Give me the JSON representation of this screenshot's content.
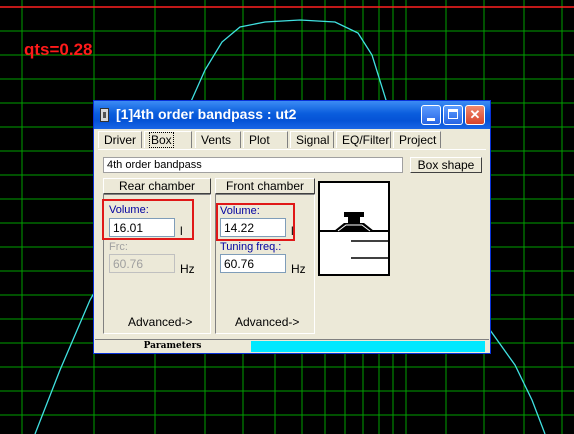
{
  "plot": {
    "annotation": "qts=0.28",
    "colors": {
      "background": "#000000",
      "grid": "#00a000",
      "curve": "#40e0e0",
      "top_line": "#ff2020",
      "annotation": "#ff1a1a"
    }
  },
  "window": {
    "title": "[1]4th order bandpass : ut2",
    "tabs": [
      "Driver",
      "Box",
      "Vents",
      "Plot",
      "Signal",
      "EQ/Filter",
      "Project"
    ],
    "active_tab": "Box",
    "box_type": "4th order bandpass",
    "box_shape_button": "Box shape",
    "rear": {
      "header": "Rear chamber",
      "volume_label": "Volume:",
      "volume_value": "16.01",
      "volume_unit": "l",
      "freq_label": "Frc:",
      "freq_value": "60.76",
      "freq_unit": "Hz",
      "advanced": "Advanced->"
    },
    "front": {
      "header": "Front chamber",
      "volume_label": "Volume:",
      "volume_value": "14.22",
      "volume_unit": "l",
      "freq_label": "Tuning freq.:",
      "freq_value": "60.76",
      "freq_unit": "Hz",
      "advanced": "Advanced->"
    },
    "status": {
      "label": "Parameters",
      "progress": 0.6
    }
  }
}
